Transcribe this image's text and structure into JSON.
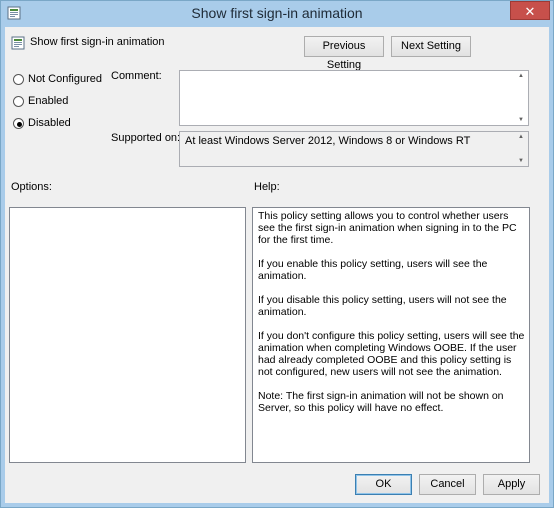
{
  "window": {
    "title": "Show first sign-in animation",
    "close_symbol": "✕",
    "icon": "policy-settings-icon"
  },
  "policy": {
    "name": "Show first sign-in animation",
    "icon": "policy-settings-icon"
  },
  "nav": {
    "previous_label": "Previous Setting",
    "next_label": "Next Setting"
  },
  "state": {
    "options": [
      {
        "label": "Not Configured",
        "checked": false
      },
      {
        "label": "Enabled",
        "checked": false
      },
      {
        "label": "Disabled",
        "checked": true
      }
    ]
  },
  "comment": {
    "label": "Comment:",
    "value": ""
  },
  "supported": {
    "label": "Supported on:",
    "value": "At least Windows Server 2012, Windows 8 or Windows RT"
  },
  "options": {
    "label": "Options:"
  },
  "help": {
    "label": "Help:",
    "paragraphs": [
      "This policy setting allows you to control whether users see the first sign-in animation when signing in to the PC for the first time.",
      "If you enable this policy setting, users will see the animation.",
      "If you disable this policy setting, users will not see the animation.",
      "If you don't configure this policy setting, users will see the animation when completing Windows OOBE.  If the user had already completed OOBE and this policy setting is not configured, new users will not see the animation.",
      "Note: The first sign-in animation will not be shown on Server, so this policy will have no effect."
    ]
  },
  "footer": {
    "ok_label": "OK",
    "cancel_label": "Cancel",
    "apply_label": "Apply"
  },
  "colors": {
    "titlebar": "#a9ccea",
    "close_button": "#c7504b",
    "dialog_background": "#f0f0f0"
  }
}
